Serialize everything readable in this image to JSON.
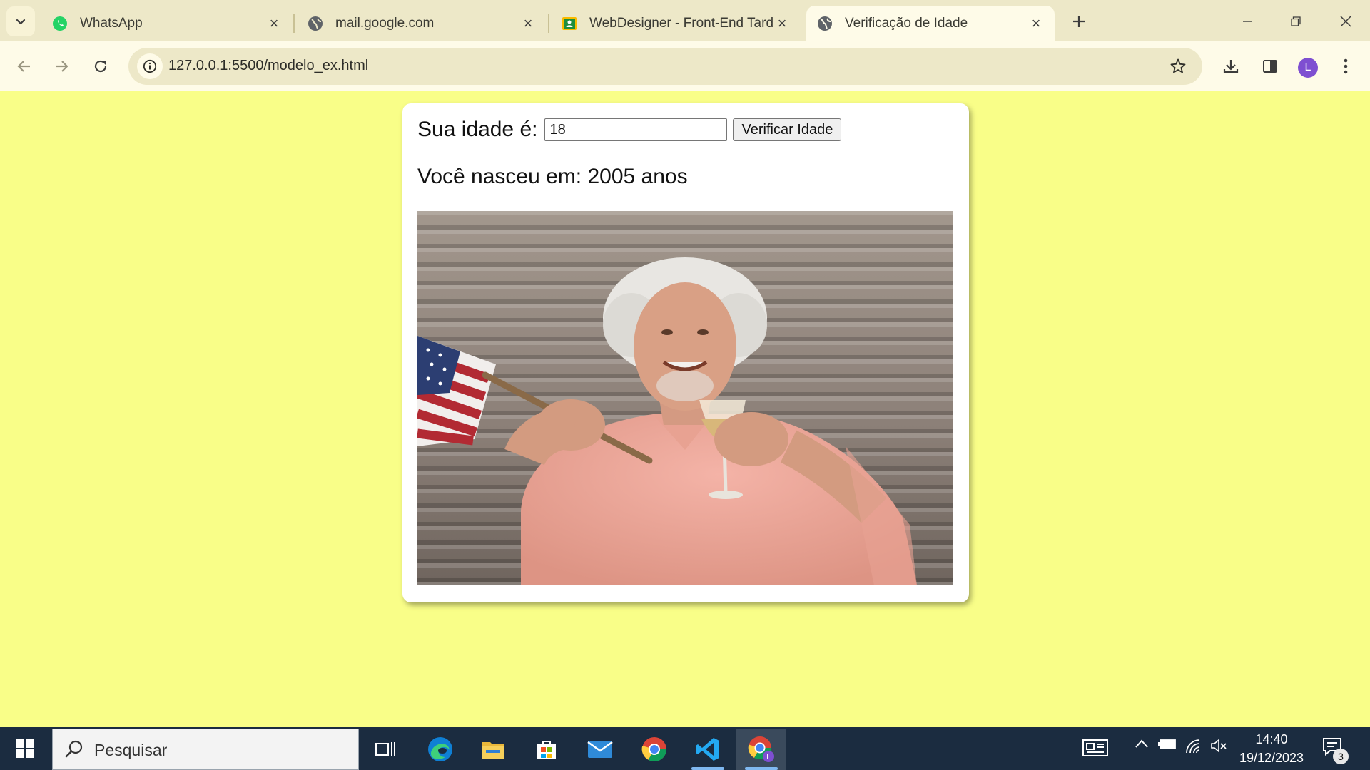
{
  "browser": {
    "tabs": [
      {
        "title": "WhatsApp",
        "icon": "whatsapp-icon",
        "active": false
      },
      {
        "title": "mail.google.com",
        "icon": "globe-icon",
        "active": false
      },
      {
        "title": "WebDesigner - Front-End Tarde",
        "icon": "classroom-icon",
        "active": false
      },
      {
        "title": "Verificação de Idade",
        "icon": "globe-icon",
        "active": true
      }
    ],
    "url": "127.0.0.1:5500/modelo_ex.html",
    "profile_initial": "L"
  },
  "page": {
    "age_label": "Sua idade é:",
    "age_value": "18",
    "verify_button": "Verificar Idade",
    "birth_text": "Você nasceu em: 2005 anos",
    "background_color": "#f9fe88"
  },
  "taskbar": {
    "search_placeholder": "Pesquisar",
    "time": "14:40",
    "date": "19/12/2023",
    "notification_count": "3",
    "apps": [
      "task-view-icon",
      "edge-icon",
      "file-explorer-icon",
      "microsoft-store-icon",
      "mail-icon",
      "chrome-icon",
      "vscode-icon",
      "chrome-profile-icon"
    ]
  }
}
